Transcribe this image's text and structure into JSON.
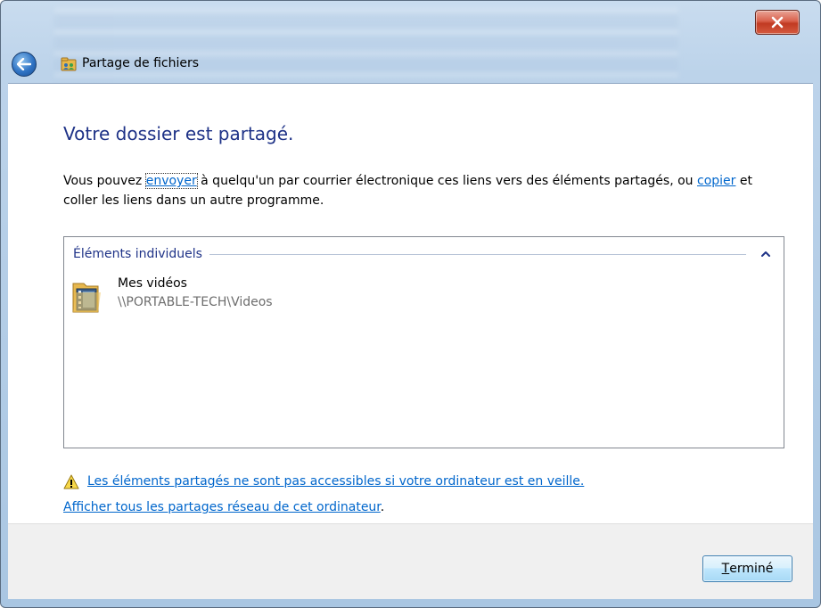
{
  "window": {
    "title": "Partage de fichiers"
  },
  "heading": "Votre dossier est partagé.",
  "intro": {
    "part1": "Vous pouvez ",
    "send_link": "envoyer",
    "part2": " à quelqu'un par courrier électronique ces liens vers des éléments partagés, ou ",
    "copy_link": "copier",
    "part3": " et coller les liens dans un autre programme."
  },
  "items_group": {
    "label": "Éléments individuels",
    "items": [
      {
        "name": "Mes vidéos",
        "path": "\\\\PORTABLE-TECH\\Videos"
      }
    ]
  },
  "warning": {
    "text": "Les éléments partagés ne sont pas accessibles si votre ordinateur est en veille."
  },
  "network_link": {
    "text": "Afficher tous les partages réseau de cet ordinateur",
    "suffix": "."
  },
  "footer": {
    "done_mnemonic": "T",
    "done_rest": "erminé"
  },
  "icons": {
    "back": "back-arrow-icon",
    "app": "file-sharing-icon",
    "close": "close-icon",
    "collapse": "chevron-up-icon",
    "folder": "video-folder-icon",
    "warning": "warning-icon"
  },
  "colors": {
    "heading": "#1e3287",
    "link": "#0066cc",
    "path_text": "#6d6d6d",
    "close_button": "#c13a22",
    "footer_bg": "#f0f0f0"
  }
}
